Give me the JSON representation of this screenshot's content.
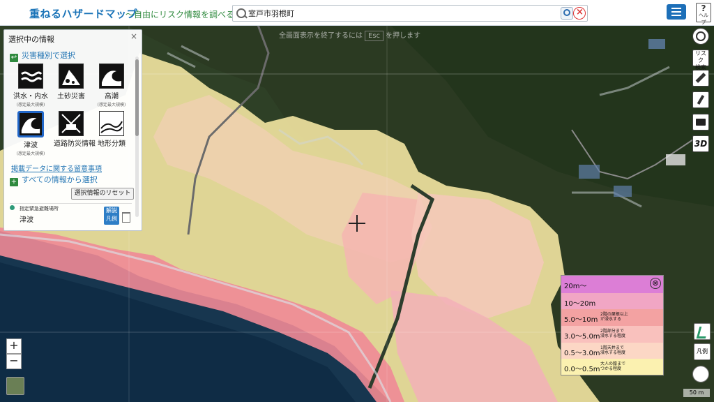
{
  "app": {
    "title": "重ねるハザードマップ",
    "tagline": "〜自由にリスク情報を調べる〜",
    "help_label": "?",
    "help_sub": "ヘルプ"
  },
  "search": {
    "value": "室戸市羽根町"
  },
  "map": {
    "fullscreen_hint_prefix": "全画面表示を終了するには",
    "fullscreen_key": "Esc",
    "fullscreen_hint_suffix": "を押します"
  },
  "panel": {
    "title": "選択中の情報",
    "close": "×",
    "by_type_label": "災害種別で選択",
    "hazards": [
      {
        "label": "洪水・内水",
        "sub": "(想定最大規模)",
        "icon": "flood-icon",
        "selected": false
      },
      {
        "label": "土砂災害",
        "sub": "",
        "icon": "landslide-icon",
        "selected": false
      },
      {
        "label": "高潮",
        "sub": "(想定最大規模)",
        "icon": "storm-surge-icon",
        "selected": false
      },
      {
        "label": "津波",
        "sub": "(想定最大規模)",
        "icon": "tsunami-icon",
        "selected": true
      },
      {
        "label": "道路防災情報",
        "sub": "",
        "icon": "road-icon",
        "selected": false
      },
      {
        "label": "地形分類",
        "sub": "",
        "icon": "terrain-icon",
        "selected": false
      }
    ],
    "notes_link": "掲載データに関する留意事項",
    "all_info_label": "すべての情報から選択",
    "reset_label": "選択情報のリセット",
    "layer": {
      "caption": "指定緊急避難場所",
      "name": "津波",
      "legend_btn_line1": "解説",
      "legend_btn_line2": "凡例"
    }
  },
  "tools": {
    "risk_label_1": "リスク",
    "risk_label_2": "検索",
    "three_d": "3D"
  },
  "legend": {
    "close": "⊗",
    "rows": [
      {
        "range": "20m〜",
        "desc": "",
        "color": "#dc7ed6"
      },
      {
        "range": "10〜20m",
        "desc": "",
        "color": "#f1a6c4"
      },
      {
        "range": "5.0〜10m",
        "desc": "2階の屋根以上\nが浸水する",
        "color": "#f3a2a2"
      },
      {
        "range": "3.0〜5.0m",
        "desc": "2階部分まで\n浸水する程度",
        "color": "#f9c1bd"
      },
      {
        "range": "0.5〜3.0m",
        "desc": "1階天井まで\n浸水する程度",
        "color": "#fcd7c5"
      },
      {
        "range": "0.0〜0.5m",
        "desc": "大人の膝まで\nつかる程度",
        "color": "#fbf1b0"
      }
    ]
  },
  "controls": {
    "zoom_in": "+",
    "zoom_out": "−",
    "legend_small": "凡例",
    "scale": "50 m"
  }
}
